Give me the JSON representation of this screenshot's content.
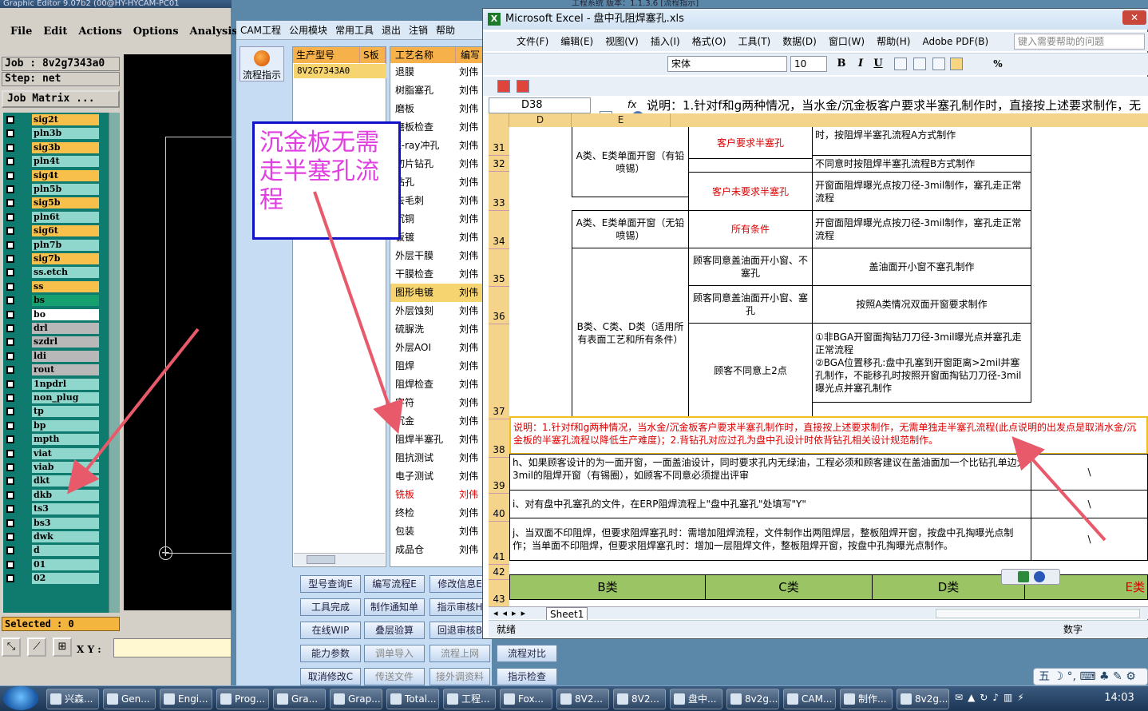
{
  "graphic_editor": {
    "title": "Graphic Editor 9.07b2 (00@HY-HYCAM-PC01",
    "menu": [
      "File",
      "Edit",
      "Actions",
      "Options",
      "Analysis"
    ],
    "job_label": "Job : 8v2g7343a0",
    "step_label": "Step: net",
    "matrix_label": "Job Matrix ...",
    "layers": [
      {
        "name": "sig2t",
        "color": "#f6c04a"
      },
      {
        "name": "pln3b",
        "color": "#8fd6cc"
      },
      {
        "name": "sig3b",
        "color": "#f6c04a"
      },
      {
        "name": "pln4t",
        "color": "#8fd6cc"
      },
      {
        "name": "sig4t",
        "color": "#f6c04a"
      },
      {
        "name": "pln5b",
        "color": "#8fd6cc"
      },
      {
        "name": "sig5b",
        "color": "#f6c04a"
      },
      {
        "name": "pln6t",
        "color": "#8fd6cc"
      },
      {
        "name": "sig6t",
        "color": "#f6c04a"
      },
      {
        "name": "pln7b",
        "color": "#8fd6cc"
      },
      {
        "name": "sig7b",
        "color": "#f6c04a"
      },
      {
        "name": "ss.etch",
        "color": "#8fd6cc"
      },
      {
        "name": "ss",
        "color": "#f6c04a"
      },
      {
        "name": "bs",
        "color": "#16a070"
      },
      {
        "name": "bo",
        "color": "#ffffff"
      },
      {
        "name": "drl",
        "color": "#b8b8b8"
      },
      {
        "name": "szdrl",
        "color": "#b8b8b8"
      },
      {
        "name": "ldi",
        "color": "#b8b8b8"
      },
      {
        "name": "rout",
        "color": "#b8b8b8"
      },
      {
        "name": "1npdrl",
        "color": "#8fd6cc"
      },
      {
        "name": "non_plug",
        "color": "#8fd6cc"
      },
      {
        "name": "tp",
        "color": "#8fd6cc"
      },
      {
        "name": "bp",
        "color": "#8fd6cc"
      },
      {
        "name": "mpth",
        "color": "#8fd6cc"
      },
      {
        "name": "viat",
        "color": "#8fd6cc"
      },
      {
        "name": "viab",
        "color": "#8fd6cc"
      },
      {
        "name": "dkt",
        "color": "#8fd6cc"
      },
      {
        "name": "dkb",
        "color": "#8fd6cc"
      },
      {
        "name": "ts3",
        "color": "#8fd6cc"
      },
      {
        "name": "bs3",
        "color": "#8fd6cc"
      },
      {
        "name": "dwk",
        "color": "#8fd6cc"
      },
      {
        "name": "d",
        "color": "#8fd6cc"
      },
      {
        "name": "01",
        "color": "#8fd6cc"
      },
      {
        "name": "02",
        "color": "#8fd6cc"
      }
    ],
    "selected_label": "Selected : 0",
    "xy_label": "X Y :"
  },
  "cam": {
    "top_title": "工程系统 版本：1.1.3.6 [流程指示]",
    "tabs": [
      "CAM工程",
      "公用模块",
      "常用工具",
      "退出",
      "注销",
      "帮助"
    ],
    "flow_button": "流程指示",
    "grid1_headers": [
      "生产型号",
      "S板"
    ],
    "model_value": "8V2G7343A0",
    "grid2_headers": [
      "工艺名称",
      "编写"
    ],
    "processes": [
      {
        "name": "退膜",
        "author": "刘伟",
        "state": ""
      },
      {
        "name": "树脂塞孔",
        "author": "刘伟",
        "state": ""
      },
      {
        "name": "磨板",
        "author": "刘伟",
        "state": ""
      },
      {
        "name": "磨板检查",
        "author": "刘伟",
        "state": ""
      },
      {
        "name": "X-ray冲孔",
        "author": "刘伟",
        "state": ""
      },
      {
        "name": "切片钻孔",
        "author": "刘伟",
        "state": ""
      },
      {
        "name": "钻孔",
        "author": "刘伟",
        "state": ""
      },
      {
        "name": "去毛刺",
        "author": "刘伟",
        "state": ""
      },
      {
        "name": "沉铜",
        "author": "刘伟",
        "state": ""
      },
      {
        "name": "板镀",
        "author": "刘伟",
        "state": ""
      },
      {
        "name": "外层干膜",
        "author": "刘伟",
        "state": ""
      },
      {
        "name": "干膜检查",
        "author": "刘伟",
        "state": ""
      },
      {
        "name": "图形电镀",
        "author": "刘伟",
        "state": "sel"
      },
      {
        "name": "外层蚀刻",
        "author": "刘伟",
        "state": ""
      },
      {
        "name": "硫脲洗",
        "author": "刘伟",
        "state": ""
      },
      {
        "name": "外层AOI",
        "author": "刘伟",
        "state": ""
      },
      {
        "name": "阻焊",
        "author": "刘伟",
        "state": ""
      },
      {
        "name": "阻焊检查",
        "author": "刘伟",
        "state": ""
      },
      {
        "name": "字符",
        "author": "刘伟",
        "state": ""
      },
      {
        "name": "沉金",
        "author": "刘伟",
        "state": ""
      },
      {
        "name": "阻焊半塞孔",
        "author": "刘伟",
        "state": ""
      },
      {
        "name": "阻抗测试",
        "author": "刘伟",
        "state": ""
      },
      {
        "name": "电子测试",
        "author": "刘伟",
        "state": ""
      },
      {
        "name": "铣板",
        "author": "刘伟",
        "state": "red"
      },
      {
        "name": "终检",
        "author": "刘伟",
        "state": ""
      },
      {
        "name": "包装",
        "author": "刘伟",
        "state": ""
      },
      {
        "name": "成品仓",
        "author": "刘伟",
        "state": ""
      }
    ],
    "buttons": [
      [
        "型号查询E",
        "编写流程E",
        "修改信息E"
      ],
      [
        "工具完成",
        "制作通知单",
        "指示审核H"
      ],
      [
        "在线WIP",
        "叠层验算",
        "回退审核B"
      ],
      [
        "能力参数",
        "调单导入",
        "流程上网",
        "流程对比"
      ],
      [
        "取消修改C",
        "传送文件",
        "接外调资料",
        "指示检查"
      ]
    ]
  },
  "annotation": {
    "text": "沉金板无需走半塞孔流程"
  },
  "excel": {
    "title": "Microsoft Excel - 盘中孔阻焊塞孔.xls",
    "menu": [
      "文件(F)",
      "编辑(E)",
      "视图(V)",
      "插入(I)",
      "格式(O)",
      "工具(T)",
      "数据(D)",
      "窗口(W)",
      "帮助(H)",
      "Adobe PDF(B)"
    ],
    "help_placeholder": "键入需要帮助的问题",
    "font_name": "宋体",
    "font_size": "10",
    "name_box": "D38",
    "fx": "fx",
    "formula": "说明：1.针对f和g两种情况，当水金/沉金板客户要求半塞孔制作时，直接按上述要求制作，无需单独走半塞孔流程(此点说明的出发点是取消水金/沉金板的半塞孔流程以降低生产难度)；2.背钻孔对应过孔为盘中孔设计时依背钻孔相关设计规范制作。",
    "columns": [
      "D",
      "E"
    ],
    "rows": [
      "31",
      "32",
      "33",
      "34",
      "35",
      "36",
      "37",
      "38",
      "39",
      "40",
      "41",
      "42",
      "43"
    ],
    "cells": {
      "r31_client": "客户要求半塞孔",
      "r31_rule": "时，按阻焊半塞孔流程A方式制作",
      "r32_group": "A类、E类单面开窗（有铅喷锡）",
      "r32_rule": "不同意时按阻焊半塞孔流程B方式制作",
      "r33_client": "客户未要求半塞孔",
      "r33_rule": "开窗面阻焊曝光点按刀径-3mil制作，塞孔走正常流程",
      "r34_group": "A类、E类单面开窗（无铅喷锡）",
      "r34_client": "所有条件",
      "r34_rule": "开窗面阻焊曝光点按刀径-3mil制作，塞孔走正常流程",
      "r35_cond": "顾客同意盖油面开小窗、不塞孔",
      "r35_rule": "盖油面开小窗不塞孔制作",
      "r36_group": "B类、C类、D类（适用所有表面工艺和所有条件）",
      "r36_cond": "顾客同意盖油面开小窗、塞孔",
      "r36_rule": "按照A类情况双面开窗要求制作",
      "r37_cond": "顾客不同意上2点",
      "r37_rule": "①非BGA开窗面掏钻刀刀径-3mil曝光点并塞孔走正常流程\n②BGA位置移孔:盘中孔塞到开窗距离>2mil并塞孔制作，不能移孔时按照开窗面掏钻刀刀径-3mil曝光点并塞孔制作",
      "r38": "说明：1.针对f和g两种情况，当水金/沉金板客户要求半塞孔制作时，直接按上述要求制作，无需单独走半塞孔流程(此点说明的出发点是取消水金/沉金板的半塞孔流程以降低生产难度)；2.背钻孔对应过孔为盘中孔设计时依背钻孔相关设计规范制作。",
      "r39": "h、如果顾客设计的为一面开窗，一面盖油设计，同时要求孔内无绿油，工程必须和顾客建议在盖油面加一个比钻孔单边大3mil的阻焊开窗（有锡圈），如顾客不同意必须提出评审",
      "r40": "i、对有盘中孔塞孔的文件，在ERP阻焊流程上\"盘中孔塞孔\"处填写\"Y\"",
      "r41": "j、当双面不印阻焊，但要求阻焊塞孔时：需增加阻焊流程，文件制作出两阻焊层，整板阻焊开窗，按盘中孔掏曝光点制作；当单面不印阻焊，但要求阻焊塞孔时：增加一层阻焊文件，整板阻焊开窗，按盘中孔掏曝光点制作。",
      "slash": "\\",
      "r43_b": "B类",
      "r43_c": "C类",
      "r43_d": "D类",
      "r43_e": "E类"
    },
    "sheet_tab": "Sheet1",
    "status_left": "就绪",
    "status_right": "数字"
  },
  "taskbar": {
    "items": [
      "兴森...",
      "Gen...",
      "Engi...",
      "Prog...",
      "Gra...",
      "Grap...",
      "Total...",
      "工程...",
      "Fox...",
      "8V2...",
      "8V2...",
      "盘中...",
      "8v2g...",
      "CAM...",
      "制作...",
      "8v2g..."
    ],
    "clock": "14:03",
    "ime": "五"
  }
}
